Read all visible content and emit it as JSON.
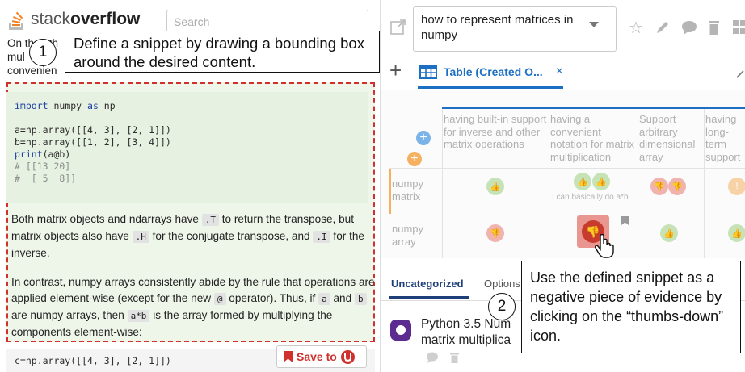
{
  "left_pane": {
    "logo": {
      "stack": "stack",
      "overflow": "overflow"
    },
    "search_placeholder": "Search",
    "intro": {
      "line1": "On the oth",
      "line2": "mul",
      "line3": "convenien"
    },
    "code1": {
      "l1": {
        "kw": "import",
        "mid": " numpy ",
        "kw2": "as",
        "end": " np"
      },
      "l3": "a=np.array([[4, 3], [2, 1]])",
      "l4": "b=np.array([[1, 2], [3, 4]])",
      "l5": {
        "fn": "print",
        "arg": "(a@b)"
      },
      "l6": "# [[13 20]",
      "l7": "#  [ 5  8]]"
    },
    "para1": {
      "t1": "Both matrix objects and ndarrays have ",
      "c1": ".T",
      "t2": " to return the transpose, but matrix objects also have ",
      "c2": ".H",
      "t3": " for the conjugate transpose, and ",
      "c3": ".I",
      "t4": " for the inverse."
    },
    "para2": {
      "t1": "In contrast, numpy arrays consistently abide by the rule that operations are applied element-wise (except for the new ",
      "c1": "@",
      "t2": " operator). Thus, if ",
      "c2": "a",
      "t3": " and ",
      "c3": "b",
      "t4": " are numpy arrays, then ",
      "c4": "a*b",
      "t5": " is the array formed by multiplying the components element-wise:"
    },
    "code2": "c=np.array([[4, 3], [2, 1]])",
    "save_to": "Save to"
  },
  "callouts": {
    "one": {
      "number": "1",
      "text": "Define a snippet by drawing a bounding box around the desired content."
    },
    "two": {
      "number": "2",
      "text": "Use the defined snippet as a negative piece of evidence by clicking on the “thumbs-down” icon."
    }
  },
  "right_pane": {
    "question": "how to represent matrices in numpy",
    "tab_label": "Table (Created O...",
    "tab_close": "×",
    "add": "+",
    "criteria": [
      "having built-in support for inverse and other matrix operations",
      "having a convenient notation for matrix multiplication",
      "Support arbitrary dimensional array",
      "having long-term support"
    ],
    "options": [
      {
        "label": "numpy matrix"
      },
      {
        "label": "numpy array"
      }
    ],
    "cell_note": "I can basically do a*b",
    "lower_tabs": {
      "uncategorized": "Uncategorized",
      "options": "Options"
    },
    "card_title": {
      "l1": "Python 3.5 Num",
      "l2": "matrix multiplica"
    },
    "colors": {
      "accent": "#1d6fc3",
      "down": "#c73b2e",
      "up": "#a8d591",
      "snippet_border": "#d0312d"
    }
  }
}
